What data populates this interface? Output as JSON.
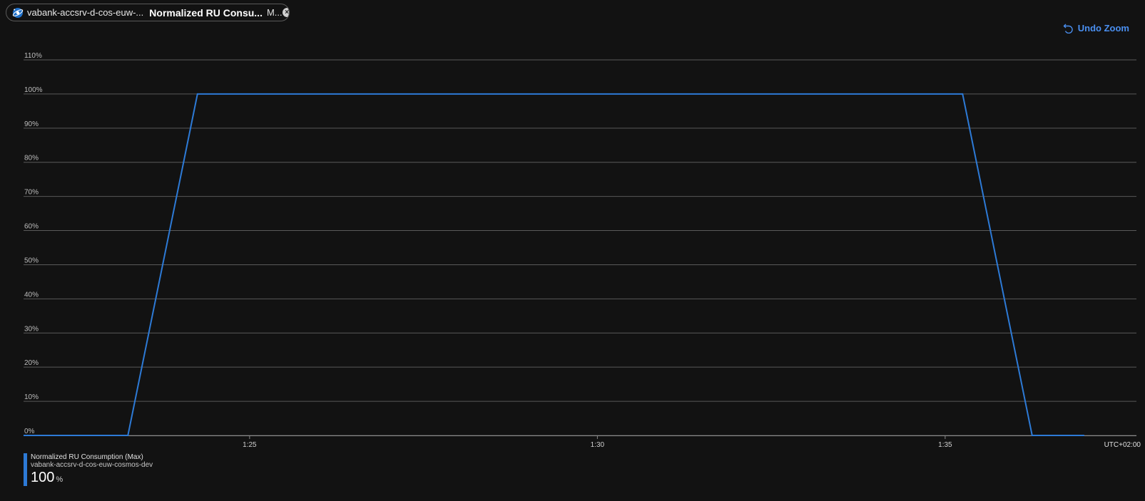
{
  "header": {
    "resource": "vabank-accsrv-d-cos-euw-...",
    "metric": "Normalized RU Consu...",
    "aggregation": "M...",
    "resource_icon": "cosmos-db-icon",
    "close_icon": "close-circle-icon"
  },
  "toolbar": {
    "undo_zoom_label": "Undo Zoom",
    "undo_icon": "undo-icon"
  },
  "colors": {
    "series": "#2d7ad6",
    "grid": "#5a5a5a",
    "accent": "#4a8ff0"
  },
  "chart_data": {
    "type": "line",
    "title": "",
    "xlabel": "",
    "ylabel": "",
    "timezone_label": "UTC+02:00",
    "ylim": [
      0,
      110
    ],
    "yticks": [
      0,
      10,
      20,
      30,
      40,
      50,
      60,
      70,
      80,
      90,
      100,
      110
    ],
    "ytick_labels": [
      "0%",
      "10%",
      "20%",
      "30%",
      "40%",
      "50%",
      "60%",
      "70%",
      "80%",
      "90%",
      "100%",
      "110%"
    ],
    "xlim": [
      "01:21:45",
      "01:37:45"
    ],
    "xticks": [
      "01:25",
      "01:30",
      "01:35"
    ],
    "xtick_labels": [
      "1:25",
      "1:30",
      "1:35"
    ],
    "grid": true,
    "series": [
      {
        "name": "Normalized RU Consumption (Max)",
        "x": [
          "01:21:45",
          "01:23:15",
          "01:24:15",
          "01:35:15",
          "01:36:15",
          "01:37:00"
        ],
        "values": [
          0,
          0,
          100,
          100,
          0,
          0
        ]
      }
    ]
  },
  "legend": {
    "series_label": "Normalized RU Consumption (Max)",
    "resource_label": "vabank-accsrv-d-cos-euw-cosmos-dev",
    "value": "100",
    "unit": "%"
  }
}
